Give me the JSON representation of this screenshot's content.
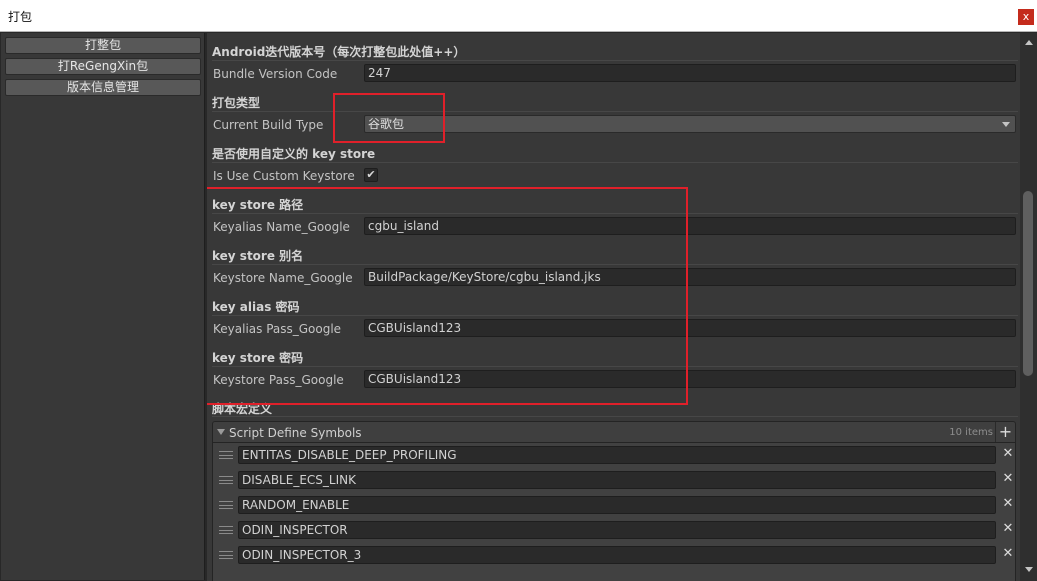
{
  "window": {
    "title": "打包",
    "close_label": "x"
  },
  "sidebar": {
    "items": [
      {
        "label": "打整包"
      },
      {
        "label": "打ReGengXin包"
      },
      {
        "label": "版本信息管理"
      }
    ]
  },
  "sections": {
    "android_version": {
      "header": "Android迭代版本号（每次打整包此处值++）",
      "label": "Bundle Version Code",
      "value": "247"
    },
    "build_type": {
      "header": "打包类型",
      "label": "Current Build Type",
      "value": "谷歌包"
    },
    "custom_keystore": {
      "header": "是否使用自定义的 key store",
      "label": "Is Use Custom Keystore",
      "checked_mark": "✔"
    },
    "keystore_path": {
      "header": "key store 路径",
      "label": "Keyalias Name_Google",
      "value": "cgbu_island"
    },
    "keystore_alias": {
      "header": "key store 别名",
      "label": "Keystore Name_Google",
      "value": "BuildPackage/KeyStore/cgbu_island.jks"
    },
    "keyalias_password": {
      "header": "key alias 密码",
      "label": "Keyalias Pass_Google",
      "value": "CGBUisland123"
    },
    "keystore_password": {
      "header": "key store 密码",
      "label": "Keystore Pass_Google",
      "value": "CGBUisland123"
    },
    "script_define": {
      "header": "脚本宏定义"
    }
  },
  "symbols_list": {
    "title": "Script Define Symbols",
    "count": "10 items",
    "add_label": "+",
    "remove_label": "✕",
    "items": [
      "ENTITAS_DISABLE_DEEP_PROFILING",
      "DISABLE_ECS_LINK",
      "RANDOM_ENABLE",
      "ODIN_INSPECTOR",
      "ODIN_INSPECTOR_3"
    ]
  },
  "colors": {
    "annotation_red": "#e0202a",
    "background": "#383838",
    "field_bg": "#2a2a2a"
  }
}
